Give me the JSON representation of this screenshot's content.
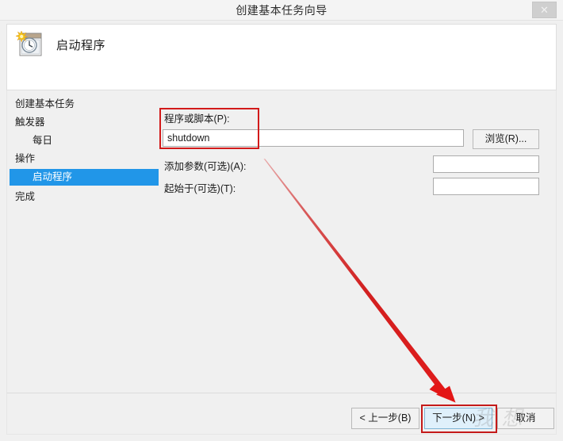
{
  "window": {
    "title": "创建基本任务向导",
    "close_label": "✕",
    "close_icon": "close-icon"
  },
  "header": {
    "icon": "task-scheduler-clock-icon",
    "title": "启动程序"
  },
  "sidebar": {
    "items": [
      {
        "label": "创建基本任务",
        "indent": false,
        "selected": false
      },
      {
        "label": "触发器",
        "indent": false,
        "selected": false
      },
      {
        "label": "每日",
        "indent": true,
        "selected": false
      },
      {
        "label": "操作",
        "indent": false,
        "selected": false
      },
      {
        "label": "启动程序",
        "indent": true,
        "selected": true
      },
      {
        "label": "完成",
        "indent": false,
        "selected": false
      }
    ],
    "selection_color": "#2196e8"
  },
  "form": {
    "program_label": "程序或脚本(P):",
    "program_value": "shutdown",
    "program_placeholder": "",
    "browse_label": "浏览(R)...",
    "args_label": "添加参数(可选)(A):",
    "args_value": "",
    "args_placeholder": "",
    "startin_label": "起始于(可选)(T):",
    "startin_value": "",
    "startin_placeholder": ""
  },
  "footer": {
    "back_label": "< 上一步(B)",
    "next_label": "下一步(N) >",
    "cancel_label": "取消"
  },
  "annotations": {
    "highlight_color": "#d21a1a",
    "arrow_color": "#e02020",
    "field_box": "program-field-highlight",
    "next_box": "next-button-highlight",
    "arrow": "pointer-arrow"
  },
  "watermark": {
    "text": "我 想"
  }
}
